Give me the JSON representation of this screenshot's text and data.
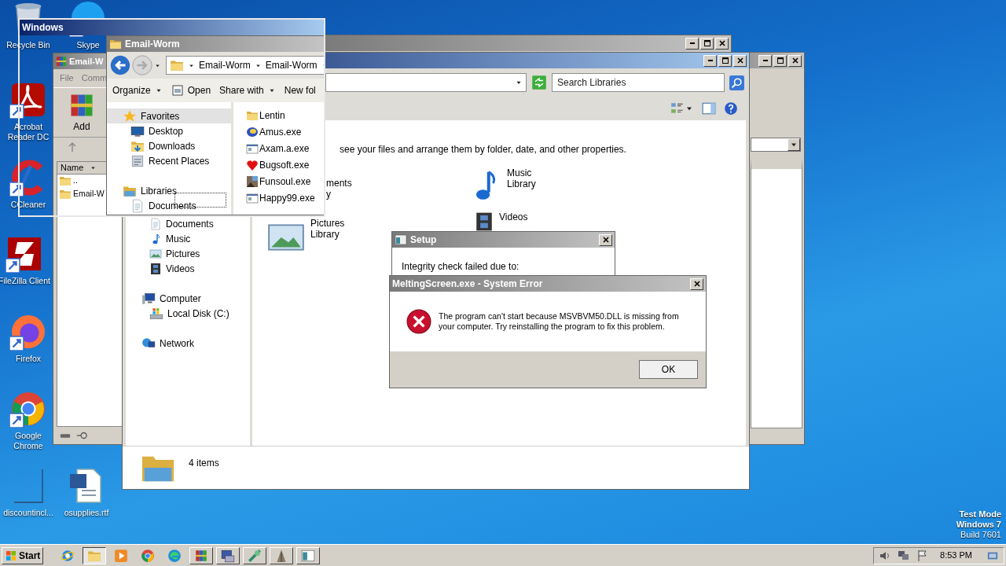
{
  "desktop_icons": [
    {
      "label_lines": [
        "Recycle Bin"
      ]
    },
    {
      "label_lines": [
        "Skype"
      ]
    },
    {
      "label_lines": [
        "Acrobat",
        "Reader DC"
      ]
    },
    {
      "label_lines": [
        "CCleaner"
      ]
    },
    {
      "label_lines": [
        "FileZilla Client"
      ]
    },
    {
      "label_lines": [
        "Firefox"
      ]
    },
    {
      "label_lines": [
        "Google",
        "Chrome"
      ]
    },
    {
      "label_lines": [
        "discountincl..."
      ]
    },
    {
      "label_lines": [
        "osupplies.rtf"
      ]
    }
  ],
  "winrar_window": {
    "title": "Email-W",
    "menu": [
      "File",
      "Comm"
    ],
    "toolbar": [
      "Add"
    ],
    "columns": [
      "Name"
    ],
    "rows": [
      "..",
      "Email-W"
    ]
  },
  "libraries_window": {
    "search": {
      "placeholder": "Search Libraries"
    },
    "nav_pane": {
      "library_items": [
        "Documents",
        "Music",
        "Pictures",
        "Videos"
      ],
      "tree": [
        {
          "label": "Computer",
          "children": [
            {
              "label": "Local Disk (C:)"
            }
          ]
        },
        {
          "label": "Network"
        }
      ]
    },
    "intro": "see your files and arrange them by folder, date, and other properties.",
    "libraries": [
      {
        "title": "ments",
        "subtitle": "y"
      },
      {
        "title": "Music",
        "subtitle": "Library"
      },
      {
        "title": "Pictures",
        "subtitle": "Library"
      },
      {
        "title": "Videos"
      }
    ],
    "status": "4 items"
  },
  "setup_dialog": {
    "title": "Setup",
    "message": "Integrity check failed due to:"
  },
  "error_dialog": {
    "title": "MeltingScreen.exe - System Error",
    "message": "The program can't start because MSVBVM50.DLL is missing from your computer. Try reinstalling the program to fix this problem.",
    "button": "OK"
  },
  "explorer_window": {
    "title": "Email-Worm",
    "breadcrumbs": [
      "Email-Worm",
      "Email-Worm"
    ],
    "toolbar": [
      {
        "label": "Organize",
        "dropdown": true
      },
      {
        "label": "Open",
        "dropdown": false
      },
      {
        "label": "Share with",
        "dropdown": true
      },
      {
        "label": "New fol",
        "dropdown": false
      }
    ],
    "nav_pane": [
      {
        "label": "Favorites",
        "selected": true,
        "children": [
          {
            "label": "Desktop",
            "selected": false
          },
          {
            "label": "Downloads",
            "selected": false
          },
          {
            "label": "Recent Places",
            "selected": false
          }
        ]
      },
      {
        "label": "Libraries",
        "selected": false,
        "children": [
          {
            "label": "Documents",
            "selected": false
          }
        ]
      }
    ],
    "files": [
      "Lentin",
      "Amus.exe",
      "Axam.a.exe",
      "Bugsoft.exe",
      "Funsoul.exe",
      "Happy99.exe"
    ]
  },
  "move_outline": {
    "title": "Windows"
  },
  "taskbar": {
    "start": "Start",
    "buttons": [
      {
        "kind": "launcher",
        "selected": false
      },
      {
        "kind": "window",
        "selected": true
      },
      {
        "kind": "launcher",
        "selected": false
      },
      {
        "kind": "launcher",
        "selected": false
      },
      {
        "kind": "launcher",
        "selected": false
      },
      {
        "kind": "window",
        "selected": false
      },
      {
        "kind": "window",
        "selected": false
      },
      {
        "kind": "window",
        "selected": false
      },
      {
        "kind": "window",
        "selected": false
      },
      {
        "kind": "window",
        "selected": false
      }
    ],
    "clock": "8:53 PM"
  },
  "desktop_notice": [
    "Test Mode",
    "Windows 7",
    "Build 7601"
  ]
}
